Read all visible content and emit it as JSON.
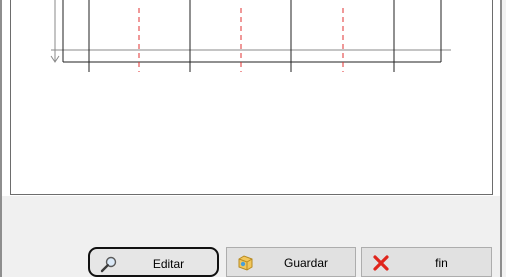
{
  "buttons": {
    "edit_label": "Editar",
    "save_label": "Guardar",
    "exit_label": "fin"
  },
  "icons": {
    "edit": "magnifier-icon",
    "save": "disk-icon",
    "exit": "red-x-icon"
  },
  "colors": {
    "exit_icon": "#e0251c",
    "edit_highlight": "#111111"
  }
}
